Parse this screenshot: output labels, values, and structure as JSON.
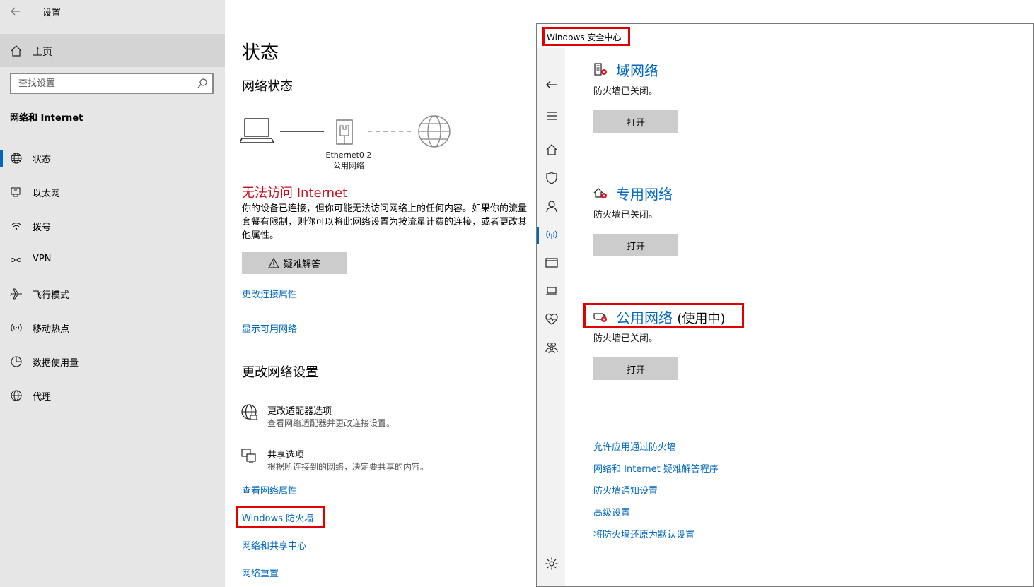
{
  "settings": {
    "app_title": "设置",
    "home_label": "主页",
    "search_placeholder": "查找设置",
    "section_heading": "网络和 Internet",
    "nav_items": [
      {
        "label": "状态",
        "icon": "globe-status-icon"
      },
      {
        "label": "以太网",
        "icon": "ethernet-icon"
      },
      {
        "label": "拨号",
        "icon": "dialup-icon"
      },
      {
        "label": "VPN",
        "icon": "vpn-icon"
      },
      {
        "label": "飞行模式",
        "icon": "airplane-icon"
      },
      {
        "label": "移动热点",
        "icon": "hotspot-icon"
      },
      {
        "label": "数据使用量",
        "icon": "data-usage-icon"
      },
      {
        "label": "代理",
        "icon": "proxy-globe-icon"
      }
    ],
    "active_nav": "状态"
  },
  "status": {
    "title": "状态",
    "subtitle": "网络状态",
    "adapter_name": "Ethernet0 2",
    "network_type": "公用网络",
    "no_internet_title": "无法访问 Internet",
    "description": "你的设备已连接，但你可能无法访问网络上的任何内容。如果你的流量套餐有限制，则你可以将此网络设置为按流量计费的连接，或者更改其他属性。",
    "troubleshoot_label": "疑难解答",
    "links_top": [
      "更改连接属性",
      "显示可用网络"
    ],
    "change_section_title": "更改网络设置",
    "options": [
      {
        "title": "更改适配器选项",
        "subtitle": "查看网络适配器并更改连接设置。"
      },
      {
        "title": "共享选项",
        "subtitle": "根据所连接到的网络，决定要共享的内容。"
      }
    ],
    "links_bottom": [
      "查看网络属性",
      "Windows 防火墙",
      "网络和共享中心",
      "网络重置"
    ]
  },
  "security": {
    "window_title": "Windows 安全中心",
    "networks": [
      {
        "name": "域网络",
        "in_use": "",
        "status": "防火墙已关闭。",
        "button": "打开",
        "icon": "domain-network-icon"
      },
      {
        "name": "专用网络",
        "in_use": "",
        "status": "防火墙已关闭。",
        "button": "打开",
        "icon": "private-network-icon"
      },
      {
        "name": "公用网络",
        "in_use": "(使用中)",
        "status": "防火墙已关闭。",
        "button": "打开",
        "icon": "public-network-icon"
      }
    ],
    "links": [
      "允许应用通过防火墙",
      "网络和 Internet 疑难解答程序",
      "防火墙通知设置",
      "高级设置",
      "将防火墙还原为默认设置"
    ],
    "colors": {
      "accent": "#0067c0",
      "highlight": "#e00000",
      "error": "#c50f1f"
    }
  }
}
